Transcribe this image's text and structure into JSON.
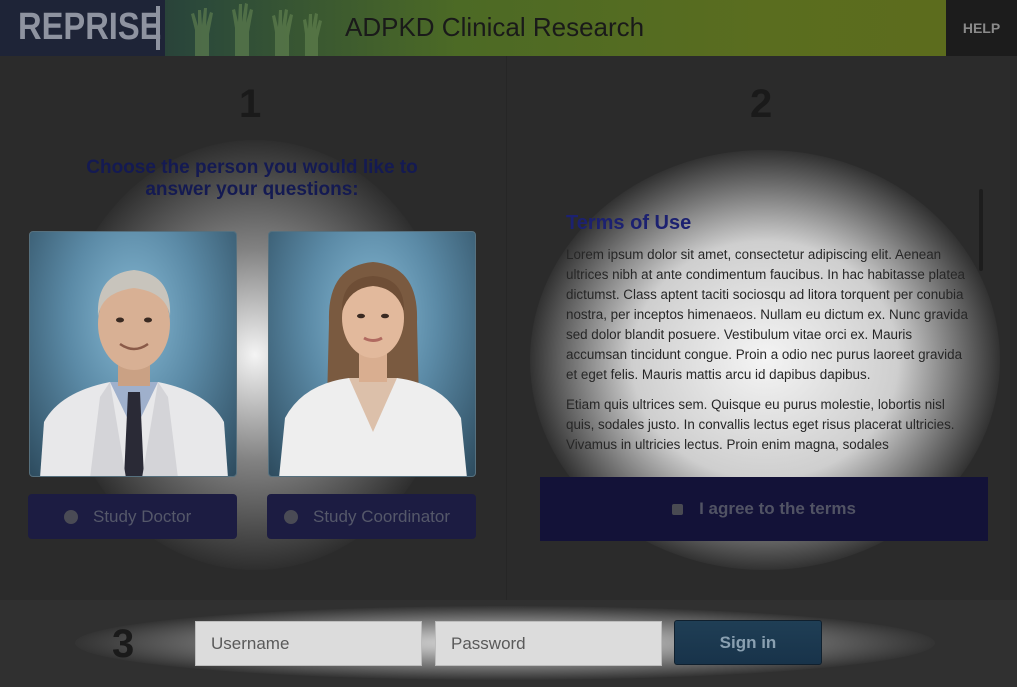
{
  "header": {
    "logo_text": "REPRISE",
    "title": "ADPKD Clinical Research",
    "help_label": "HELP"
  },
  "step1": {
    "number": "1",
    "heading": "Choose the person you would like to answer your questions:",
    "options": [
      {
        "label": "Study Doctor"
      },
      {
        "label": "Study Coordinator"
      }
    ]
  },
  "step2": {
    "number": "2",
    "terms_title": "Terms of Use",
    "paragraphs": [
      "Lorem ipsum dolor sit amet, consectetur adipiscing elit. Aenean ultrices nibh at ante condimentum faucibus. In hac habitasse platea dictumst. Class aptent taciti sociosqu ad litora torquent per conubia nostra, per inceptos himenaeos. Nullam eu dictum ex. Nunc gravida sed dolor blandit posuere. Vestibulum vitae orci ex. Mauris accumsan tincidunt congue. Proin a odio nec purus laoreet gravida et eget felis. Mauris mattis arcu id dapibus dapibus.",
      "Etiam quis ultrices sem. Quisque eu purus molestie, lobortis nisl quis, sodales justo. In convallis lectus eget risus placerat ultricies. Vivamus in ultricies lectus. Proin enim magna, sodales"
    ],
    "agree_label": "I agree to the terms"
  },
  "step3": {
    "number": "3",
    "username_placeholder": "Username",
    "password_placeholder": "Password",
    "signin_label": "Sign in"
  },
  "colors": {
    "heading_navy": "#141a52",
    "button_navy": "#1c1c42",
    "signin_blue": "#1f3e55"
  }
}
